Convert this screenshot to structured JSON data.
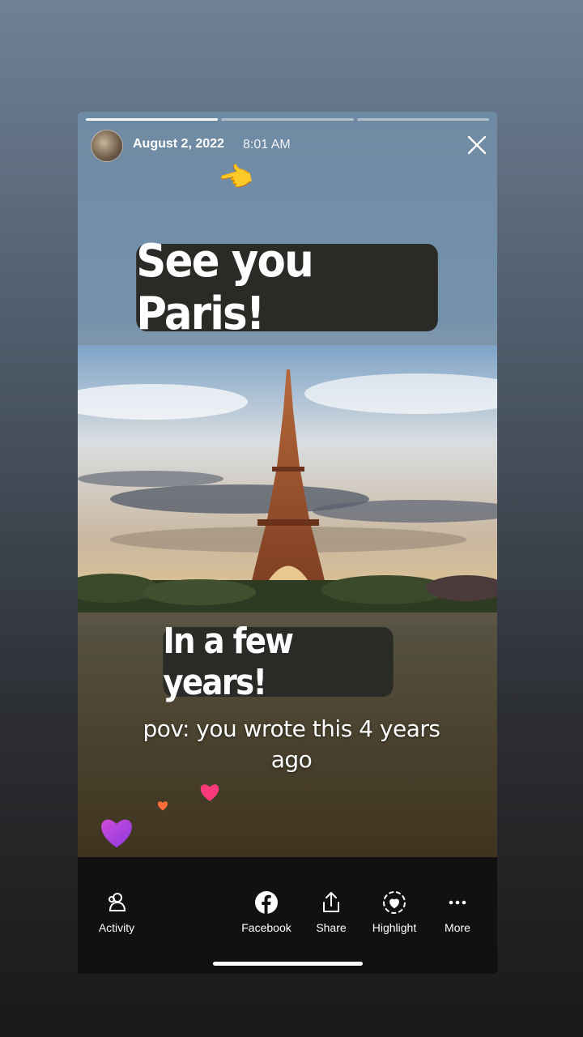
{
  "header": {
    "date": "August 2, 2022",
    "time": "8:01 AM",
    "close_icon": "close-icon",
    "avatar": "avatar"
  },
  "progress": {
    "segments": 3,
    "completed": 1
  },
  "story": {
    "emoji": "👈",
    "sticker_top": "See you Paris!",
    "sticker_bottom": "In a few years!",
    "caption_line1": "pov: you wrote this 4 years",
    "caption_line2": "ago",
    "photo_subject": "eiffel-tower"
  },
  "toolbar": {
    "activity": "Activity",
    "facebook": "Facebook",
    "share": "Share",
    "highlight": "Highlight",
    "more": "More"
  },
  "colors": {
    "heart_pink": "#ff3a7a",
    "heart_purple": "#b44be0",
    "heart_orange": "#ff6d3a"
  }
}
